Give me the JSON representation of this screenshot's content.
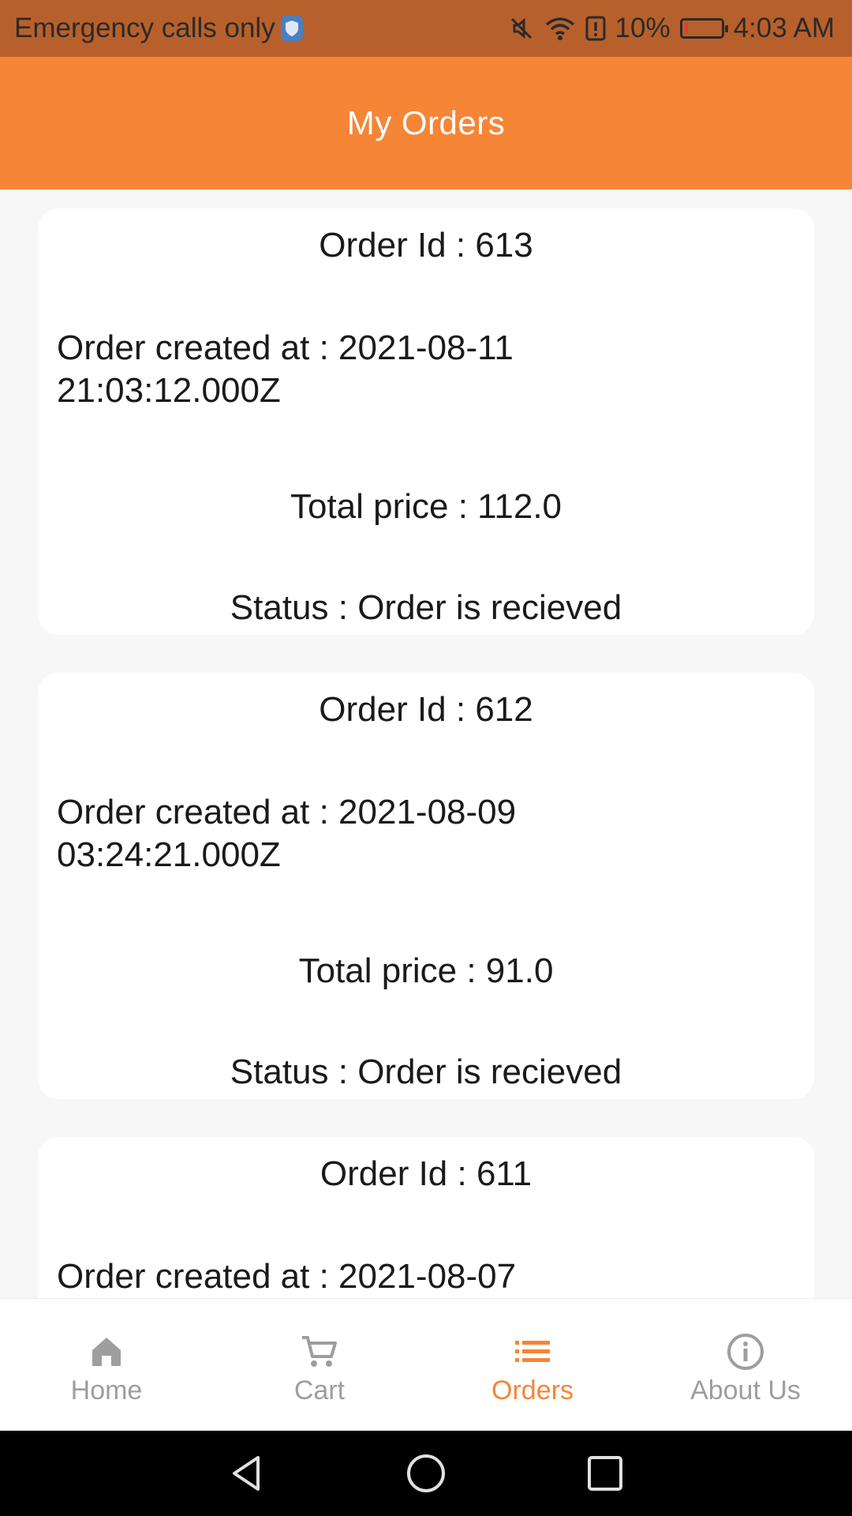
{
  "status_bar": {
    "carrier_text": "Emergency calls only",
    "battery_percent": "10%",
    "time": "4:03 AM",
    "battery_level": 0.1,
    "icons": [
      "shield-icon",
      "mute-icon",
      "wifi-icon",
      "alert-icon",
      "battery-icon"
    ]
  },
  "app_bar": {
    "title": "My Orders"
  },
  "orders": [
    {
      "id_text": "Order Id : 613",
      "created_line1": "Order created at : 2021-08-11",
      "created_line2": "21:03:12.000Z",
      "price_text": "Total price : 112.0",
      "status_text": "Status : Order is recieved"
    },
    {
      "id_text": "Order Id : 612",
      "created_line1": "Order created at : 2021-08-09",
      "created_line2": "03:24:21.000Z",
      "price_text": "Total price : 91.0",
      "status_text": "Status : Order is recieved"
    },
    {
      "id_text": "Order Id : 611",
      "created_line1": "Order created at : 2021-08-07",
      "created_line2": "",
      "price_text": "",
      "status_text": ""
    }
  ],
  "bottom_nav": {
    "items": [
      {
        "label": "Home",
        "icon": "home-icon",
        "active": false
      },
      {
        "label": "Cart",
        "icon": "cart-icon",
        "active": false
      },
      {
        "label": "Orders",
        "icon": "list-icon",
        "active": true
      },
      {
        "label": "About Us",
        "icon": "info-icon",
        "active": false
      }
    ]
  },
  "colors": {
    "status_bar": "#b8602b",
    "accent": "#f68536",
    "inactive": "#9e9e9e",
    "background": "#f7f7f7",
    "card": "#ffffff"
  },
  "system_nav": {
    "icons": [
      "back-icon",
      "home-circle-icon",
      "recents-icon"
    ]
  }
}
